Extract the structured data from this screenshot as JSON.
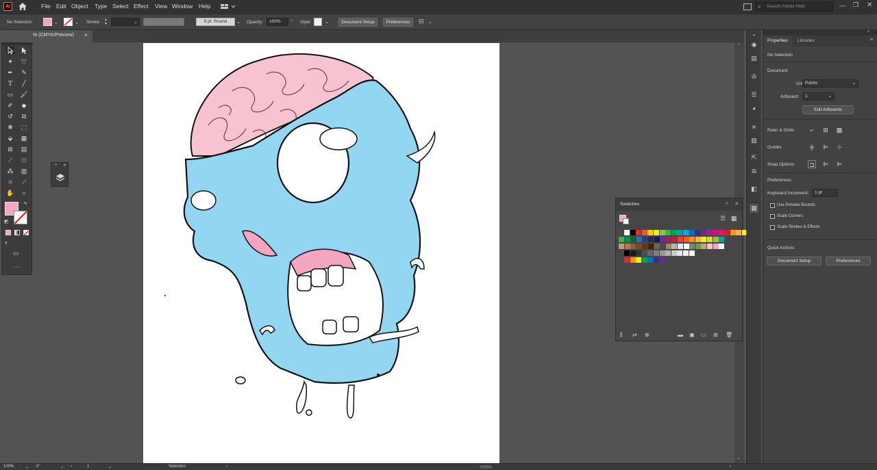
{
  "menubar": {
    "app_logo": "Ai",
    "items": [
      "File",
      "Edit",
      "Object",
      "Type",
      "Select",
      "Effect",
      "View",
      "Window",
      "Help"
    ],
    "search_placeholder": "Search Adobe Help"
  },
  "controlbar": {
    "selection_label": "No Selection",
    "stroke_label": "Stroke:",
    "stroke_profile": "5 pt. Round",
    "opacity_label": "Opacity:",
    "opacity_value": "100%",
    "style_label": "Style:",
    "document_setup": "Document Setup",
    "preferences": "Preferences"
  },
  "tab": {
    "title": "% (CMYK/Preview)",
    "close": "×"
  },
  "properties": {
    "tabs": [
      "Properties",
      "Libraries"
    ],
    "no_selection": "No Selection",
    "document_header": "Document",
    "units_label": "Units:",
    "units_value": "Points",
    "artboard_label": "Artboard:",
    "artboard_value": "1",
    "edit_artboards": "Edit Artboards",
    "ruler_grids": "Ruler & Grids",
    "guides": "Guides",
    "snap_options": "Snap Options",
    "preferences_header": "Preferences",
    "keyboard_increment_label": "Keyboard Increment:",
    "keyboard_increment_value": "1 pt",
    "use_preview_bounds": "Use Preview Bounds",
    "scale_corners": "Scale Corners",
    "scale_strokes": "Scale Strokes & Effects",
    "quick_actions": "Quick Actions",
    "qa_document_setup": "Document Setup",
    "qa_preferences": "Preferences"
  },
  "swatches": {
    "title": "Swatches",
    "rows": [
      [
        "#ffffff",
        "#000000",
        "#e8262c",
        "#f05a28",
        "#fdd20a",
        "#f3ec19",
        "#8dc63f",
        "#39b54a",
        "#00a651",
        "#00a99d",
        "#00aeef",
        "#0072bc",
        "#2e3192",
        "#662d91",
        "#92278f",
        "#ec008c",
        "#ed145b",
        "#c1272d",
        "#f7931e",
        "#fbb040",
        "#fff200",
        "#d7e021",
        "#8cc63f"
      ],
      [
        "#39b54a",
        "#009444",
        "#006838",
        "#1c75bc",
        "#2b3990",
        "#262262",
        "#1b1464",
        "#652d90",
        "#9e1f63",
        "#be1e2d",
        "#ef4136",
        "#f15a29",
        "#f7941d",
        "#fbb040",
        "#f9ed32",
        "#d7df23",
        "#8dc63f",
        "#00a79d"
      ],
      [
        "#c69c6d",
        "#a67c52",
        "#8c6239",
        "#754c24",
        "#603913",
        "#42210b",
        "#736357",
        "#534741",
        "#998675",
        "#c7b299",
        "#e6e6e6",
        "#ffffff",
        "#808080",
        "#6d9e3f",
        "#c8a082",
        "#e8c7c7",
        "#f4a9b8",
        "#ffffff"
      ],
      [
        "#000000",
        "#1a1a1a",
        "#333333",
        "#4d4d4d",
        "#666666",
        "#808080",
        "#999999",
        "#b3b3b3",
        "#cccccc",
        "#e6e6e6",
        "#f2f2f2",
        "#ffffff"
      ],
      [
        "#e8262c",
        "#f7941d",
        "#fff200",
        "#00a651",
        "#0072bc",
        "#2e3192",
        "#662d91"
      ]
    ]
  },
  "statusbar": {
    "zoom": "100%",
    "rotation": "0°",
    "artboard_num": "1",
    "mode": "Selection"
  },
  "colors": {
    "fill": "#f4a6c0",
    "skull": "#92d6f2",
    "brain": "#f7c3d0"
  }
}
